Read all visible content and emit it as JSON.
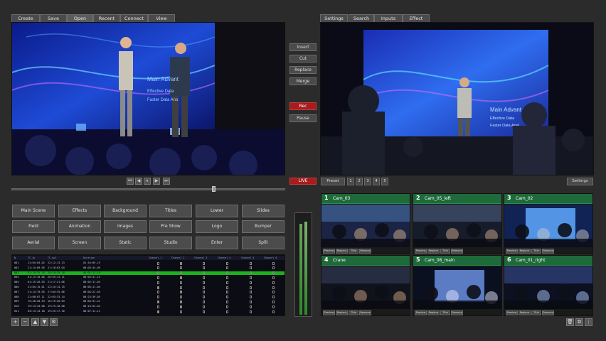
{
  "left_tabs": [
    "Create",
    "Save",
    "Open",
    "Recent",
    "Connect",
    "View"
  ],
  "right_tabs": [
    "Settings",
    "Search",
    "Inputs",
    "Effect"
  ],
  "side_buttons": [
    "Insert",
    "Cut",
    "Replace",
    "Merge"
  ],
  "rec_label": "Rec",
  "pause_label": "Pause",
  "live_label": "LIVE",
  "preset": {
    "label": "Preset",
    "numbers": [
      "1",
      "2",
      "3",
      "4",
      "5"
    ],
    "settings_label": "Settings"
  },
  "effects_grid": [
    [
      "Main Scene",
      "Effects",
      "Background",
      "Titles",
      "Lower",
      "Slides"
    ],
    [
      "Field",
      "Animation",
      "Images",
      "Pre Show",
      "Logo",
      "Bumper"
    ],
    [
      "Aerial",
      "Screen",
      "Static",
      "Studio",
      "Enter",
      "Split"
    ]
  ],
  "timeline": {
    "headers": [
      "N",
      "TC_in",
      "TC_out",
      "Duration",
      "Channel_1",
      "Channel_2",
      "Channel_3",
      "Channel_4",
      "Channel_5",
      "Channel_6"
    ],
    "rows": [
      [
        "001",
        "21:04:03.02",
        "22:12:13.13",
        "01:10:09.19"
      ],
      [
        "002",
        "21:14:09.05",
        "21:18:03.04",
        "00:03:44.09"
      ],
      [
        "003",
        "01:10:35.18",
        "20:10:35.18",
        "00:01:11.10"
      ],
      [
        "004",
        "01:13:10.06",
        "20:55:13.11",
        "00:05:51.15"
      ],
      [
        "005",
        "01:15:26.03",
        "21:17:21.06",
        "00:02:11.04"
      ],
      [
        "006",
        "21:04:15.01",
        "22:24:14.15",
        "00:05:11.04"
      ],
      [
        "007",
        "21:14:19.05",
        "27:04:35.06",
        "00:04:22.05"
      ],
      [
        "008",
        "21:08:07.11",
        "22:03:33.14",
        "00:23:39.05"
      ],
      [
        "009",
        "15:28:20.33",
        "16:19:20.03",
        "00:04:31.41"
      ],
      [
        "010",
        "19:13:34.08",
        "19:23:16.08",
        "00:13:54.02"
      ],
      [
        "011",
        "03:13:13.18",
        "19:25:17.16",
        "00:07:11.11"
      ]
    ],
    "selected_row": 2
  },
  "cameras": [
    {
      "num": "1",
      "name": "Cam_03"
    },
    {
      "num": "2",
      "name": "Cam_05_left"
    },
    {
      "num": "3",
      "name": "Cam_02"
    },
    {
      "num": "4",
      "name": "Crane"
    },
    {
      "num": "5",
      "name": "Cam_08_main"
    },
    {
      "num": "6",
      "name": "Cam_01_right"
    }
  ],
  "cam_buttons": [
    "Preview",
    "Replace",
    "Title",
    "Remove"
  ],
  "program_screen": {
    "title": "Main Advant",
    "bullets": [
      "Effective Data",
      "Faster Data Ana"
    ]
  },
  "preview_screen": {
    "title": "Main Advant",
    "bullets": [
      "Effective Data",
      "Faster Data Anal"
    ]
  },
  "colors": {
    "accent_green": "#1e6a3a",
    "live_red": "#a51d1d",
    "timeline_select": "#19b21d"
  },
  "icons": [
    "skip-back-icon",
    "step-back-icon",
    "play-pause-icon",
    "step-forward-icon",
    "skip-forward-icon",
    "plus-icon",
    "minus-icon",
    "chevron-up-icon",
    "chevron-down-icon",
    "gear-icon",
    "trash-icon",
    "copy-icon",
    "more-icon"
  ]
}
